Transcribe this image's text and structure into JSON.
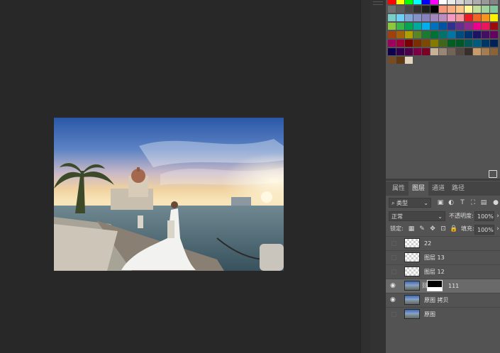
{
  "swatches": {
    "rows": [
      [
        "#ff0000",
        "#ffff00",
        "#00ff00",
        "#00ffff",
        "#0000ff",
        "#ff00ff",
        "#ffffff",
        "#ebebeb",
        "#d6d6d6",
        "#c2c2c2",
        "#adadad",
        "#999999",
        "#858585"
      ],
      [
        "#707070",
        "#5c5c5c",
        "#474747",
        "#333333",
        "#1f1f1f",
        "#000000",
        "#f7977a",
        "#f9ad81",
        "#fdc68a",
        "#fff79a",
        "#c4df9b",
        "#a3d39c",
        "#82ca9d"
      ],
      [
        "#7bcdc8",
        "#6ecff6",
        "#7ea7d8",
        "#8493ca",
        "#8882be",
        "#a187be",
        "#bc8dbf",
        "#f49ac2",
        "#f6989d",
        "#ed1c24",
        "#f26522",
        "#f7941d",
        "#fff200"
      ],
      [
        "#8dc73f",
        "#39b54a",
        "#00a651",
        "#00a99d",
        "#00aeef",
        "#0072bc",
        "#0054a6",
        "#2e3192",
        "#662d91",
        "#92278f",
        "#ec008c",
        "#ed145b",
        "#9e0b0f"
      ],
      [
        "#a0410d",
        "#a3620a",
        "#aba000",
        "#598527",
        "#1a7b30",
        "#007236",
        "#00746b",
        "#0076a3",
        "#004b80",
        "#003471",
        "#1b1464",
        "#440e62",
        "#630460"
      ],
      [
        "#9e005d",
        "#9e0039",
        "#790000",
        "#7b2e00",
        "#7d4900",
        "#827b00",
        "#406618",
        "#005e20",
        "#005826",
        "#005952",
        "#005b7f",
        "#003663",
        "#002157"
      ],
      [
        "#0d004c",
        "#32004b",
        "#4b0049",
        "#7b0046",
        "#7a0026",
        "#c7b299",
        "#998675",
        "#736357",
        "#534741",
        "#37302a",
        "#c69c6d",
        "#a67c52",
        "#8c6239"
      ],
      [
        "#754c24",
        "#603913",
        "#e4d5bf"
      ]
    ]
  },
  "tabs": [
    {
      "label": "属性",
      "active": false
    },
    {
      "label": "图层",
      "active": true
    },
    {
      "label": "通道",
      "active": false
    },
    {
      "label": "路径",
      "active": false
    }
  ],
  "layers_panel": {
    "filter_kind": "类型",
    "blend_mode": "正常",
    "opacity_label": "不透明度:",
    "opacity_value": "100%",
    "lock_label": "锁定:",
    "fill_label": "填充:",
    "fill_value": "100%",
    "icons": {
      "filter": "search-icon",
      "image": "image-filter-icon",
      "adjust": "adjustment-filter-icon",
      "text": "text-filter-icon",
      "shape": "shape-filter-icon",
      "smart": "smart-object-filter-icon"
    }
  },
  "layers": [
    {
      "name": "22",
      "visible": false,
      "thumb": "transparent",
      "mask": false,
      "selected": false
    },
    {
      "name": "图层 13",
      "visible": false,
      "thumb": "transparent",
      "mask": false,
      "selected": false
    },
    {
      "name": "图层 12",
      "visible": false,
      "thumb": "transparent",
      "mask": false,
      "selected": false
    },
    {
      "name": "111",
      "visible": true,
      "thumb": "photo",
      "mask": true,
      "selected": true
    },
    {
      "name": "原图 拷贝",
      "visible": true,
      "thumb": "photo",
      "mask": false,
      "selected": false
    },
    {
      "name": "原图",
      "visible": false,
      "thumb": "photo",
      "mask": false,
      "selected": false
    }
  ],
  "colors": {
    "canvas_bg": "#282828",
    "panel_bg": "#535353",
    "selected_layer": "#6a6a6a"
  }
}
